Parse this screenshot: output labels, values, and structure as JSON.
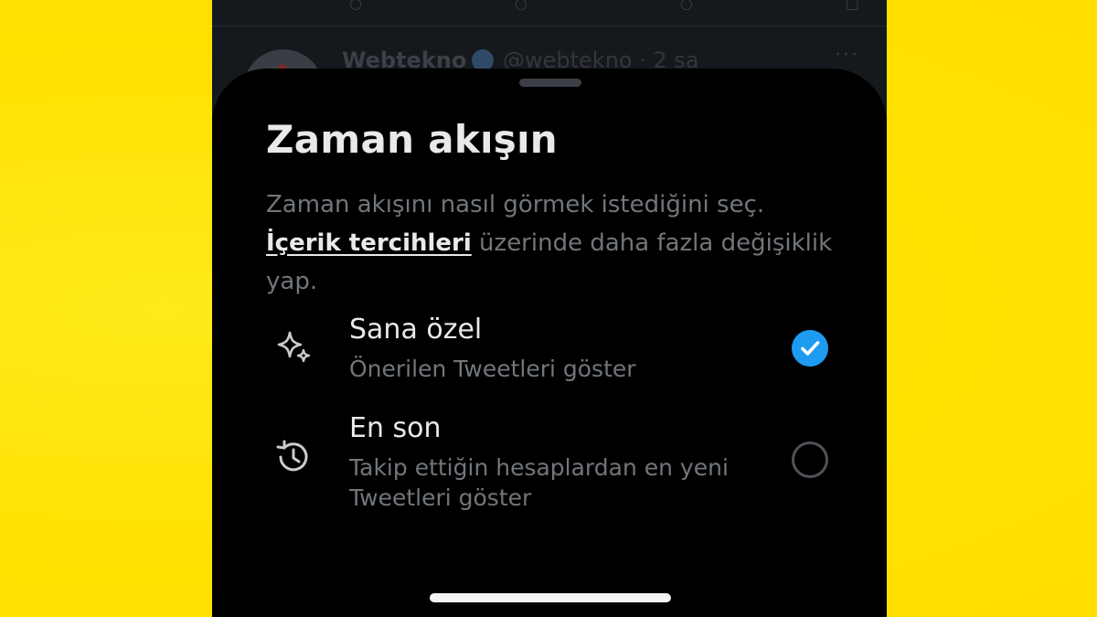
{
  "feed": {
    "account_name": "Webtekno",
    "handle_time": "@webtekno · 2 sa",
    "more_label": "···"
  },
  "sheet": {
    "title": "Zaman akışın",
    "description_before": "Zaman akışını nasıl görmek istediğini seç. ",
    "description_link": "İçerik tercihleri",
    "description_after": " üzerinde daha fazla değişiklik yap."
  },
  "options": [
    {
      "icon": "sparkle-icon",
      "title": "Sana özel",
      "subtitle": "Önerilen Tweetleri göster",
      "selected": true
    },
    {
      "icon": "history-icon",
      "title": "En son",
      "subtitle": "Takip ettiğin hesaplardan en yeni Tweetleri göster",
      "selected": false
    }
  ],
  "colors": {
    "background": "#ffe600",
    "sheet": "#000000",
    "accent": "#1d9bf0",
    "primary_text": "#e7e9ea",
    "secondary_text": "#71767b"
  }
}
